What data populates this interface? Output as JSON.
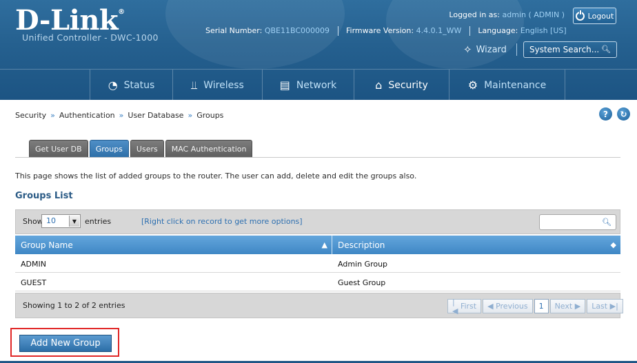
{
  "brand": {
    "logo": "D-Link",
    "reg": "®",
    "subtitle": "Unified Controller - DWC-1000"
  },
  "header": {
    "logged_in_label": "Logged in as:",
    "logged_in_value": "admin ( ADMIN )",
    "logout_label": "Logout",
    "serial_label": "Serial Number:",
    "serial_value": "QBE11BC000009",
    "firmware_label": "Firmware Version:",
    "firmware_value": "4.4.0.1_WW",
    "language_label": "Language:",
    "language_value": "English [US]",
    "wizard_label": "Wizard",
    "system_search_placeholder": "System Search..."
  },
  "nav": [
    {
      "label": "Status",
      "icon": "gauge-icon",
      "active": false
    },
    {
      "label": "Wireless",
      "icon": "wifi-icon",
      "active": false
    },
    {
      "label": "Network",
      "icon": "monitor-icon",
      "active": false
    },
    {
      "label": "Security",
      "icon": "lock-icon",
      "active": true
    },
    {
      "label": "Maintenance",
      "icon": "gears-icon",
      "active": false
    }
  ],
  "breadcrumb": [
    "Security",
    "Authentication",
    "User Database",
    "Groups"
  ],
  "tabs": [
    {
      "label": "Get User DB",
      "active": false
    },
    {
      "label": "Groups",
      "active": true
    },
    {
      "label": "Users",
      "active": false
    },
    {
      "label": "MAC Authentication",
      "active": false
    }
  ],
  "description": "This page shows the list of added groups to the router. The user can add, delete and edit the groups also.",
  "section_title": "Groups List",
  "table": {
    "show_label": "Show",
    "entries_value": "10",
    "entries_label": "entries",
    "hint": "[Right click on record to get more options]",
    "columns": [
      "Group Name",
      "Description"
    ],
    "rows": [
      {
        "name": "ADMIN",
        "description": "Admin Group"
      },
      {
        "name": "GUEST",
        "description": "Guest Group"
      }
    ],
    "showing": "Showing 1 to 2 of 2 entries",
    "pager": {
      "first": "First",
      "previous": "Previous",
      "current": "1",
      "next": "Next",
      "last": "Last"
    }
  },
  "add_button_label": "Add New Group",
  "colors": {
    "header_blue": "#25608f",
    "accent": "#3f87c5",
    "highlight_red": "#e02626"
  }
}
